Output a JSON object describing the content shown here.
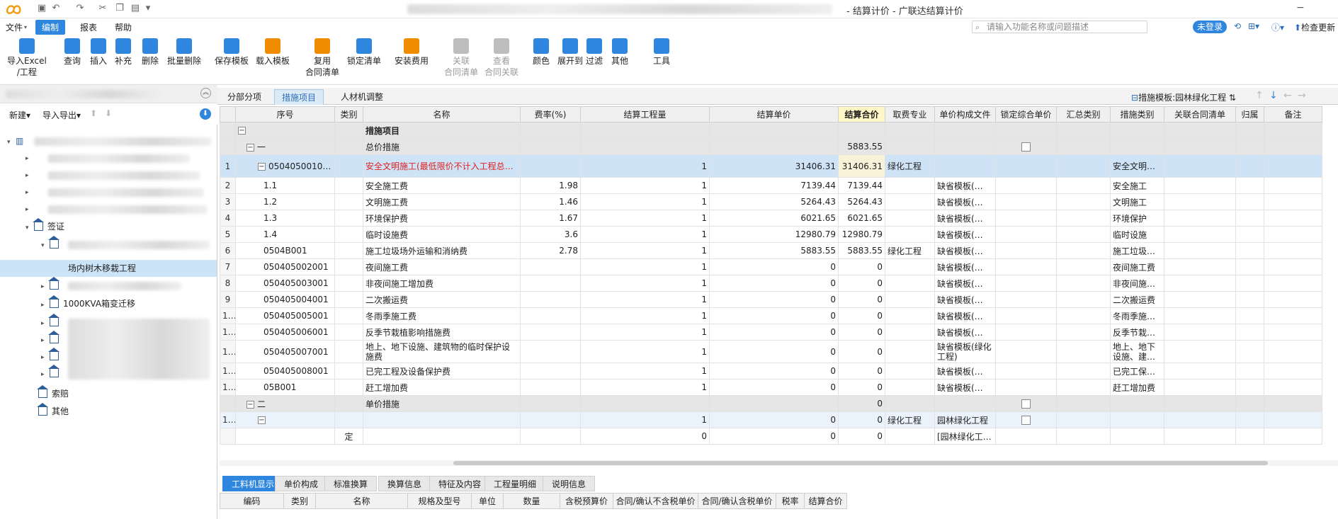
{
  "window": {
    "title": "- 结算计价 - 广联达结算计价"
  },
  "quick_access": [
    "save-icon",
    "undo-icon",
    "redo-icon",
    "cut-icon",
    "copy-icon",
    "paste-icon",
    "more-icon"
  ],
  "menu": [
    "文件",
    "编制",
    "报表",
    "帮助"
  ],
  "search": {
    "placeholder": "请输入功能名称或问题描述"
  },
  "login_label": "未登录",
  "check_update": "检查更新",
  "toolbar": [
    {
      "line1": "导入Excel",
      "line2": "/工程",
      "icon": "import-excel-icon",
      "color": "#2e86de",
      "disabled": false
    },
    {
      "line1": "查询",
      "line2": "",
      "icon": "query-icon",
      "color": "#2e86de",
      "disabled": false
    },
    {
      "line1": "插入",
      "line2": "",
      "icon": "insert-icon",
      "color": "#2e86de",
      "disabled": false
    },
    {
      "line1": "补充",
      "line2": "",
      "icon": "supplement-icon",
      "color": "#2e86de",
      "disabled": false
    },
    {
      "line1": "删除",
      "line2": "",
      "icon": "delete-icon",
      "color": "#2e86de",
      "disabled": false
    },
    {
      "line1": "批量删除",
      "line2": "",
      "icon": "batch-delete-icon",
      "color": "#2e86de",
      "disabled": false
    },
    {
      "line1": "保存模板",
      "line2": "",
      "icon": "save-template-icon",
      "color": "#2e86de",
      "disabled": false
    },
    {
      "line1": "载入模板",
      "line2": "",
      "icon": "load-template-icon",
      "color": "#f08c00",
      "disabled": false
    },
    {
      "line1": "复用",
      "line2": "合同清单",
      "icon": "reuse-list-icon",
      "color": "#f08c00",
      "disabled": false
    },
    {
      "line1": "锁定清单",
      "line2": "",
      "icon": "lock-icon",
      "color": "#2e86de",
      "disabled": false
    },
    {
      "line1": "安装费用",
      "line2": "",
      "icon": "install-fee-icon",
      "color": "#f08c00",
      "disabled": false
    },
    {
      "line1": "关联",
      "line2": "合同清单",
      "icon": "link-list-icon",
      "color": "#bdbdbd",
      "disabled": true
    },
    {
      "line1": "查看",
      "line2": "合同关联",
      "icon": "view-link-icon",
      "color": "#bdbdbd",
      "disabled": true
    },
    {
      "line1": "颜色",
      "line2": "",
      "icon": "color-icon",
      "color": "#2e86de",
      "disabled": false
    },
    {
      "line1": "展开到",
      "line2": "",
      "icon": "expand-icon",
      "color": "#2e86de",
      "disabled": false
    },
    {
      "line1": "过滤",
      "line2": "",
      "icon": "filter-icon",
      "color": "#2e86de",
      "disabled": false
    },
    {
      "line1": "其他",
      "line2": "",
      "icon": "other-icon",
      "color": "#2e86de",
      "disabled": false
    },
    {
      "line1": "工具",
      "line2": "",
      "icon": "tool-icon",
      "color": "#2e86de",
      "disabled": false
    }
  ],
  "left": {
    "new_label": "新建",
    "import_export_label": "导入导出",
    "tree": [
      {
        "label": "签证",
        "level": 1,
        "icon": "house-icon",
        "expanded": true
      },
      {
        "label": "场内树木移栽工程",
        "level": 3,
        "icon": "",
        "selected": true
      },
      {
        "label": "1000KVA箱变迁移",
        "level": 2,
        "icon": "house-icon"
      },
      {
        "label": "索赔",
        "level": 1,
        "icon": "house-icon"
      },
      {
        "label": "其他",
        "level": 1,
        "icon": "house-icon"
      }
    ]
  },
  "tabs": [
    "分部分项",
    "措施项目",
    "人材机调整"
  ],
  "measure_template_label": "措施模板:园林绿化工程",
  "table": {
    "headers": [
      "序号",
      "类别",
      "名称",
      "费率(%)",
      "结算工程量",
      "结算单价",
      "结算合价",
      "取费专业",
      "单价构成文件",
      "锁定综合单价",
      "汇总类别",
      "措施类别",
      "关联合同清单",
      "归属",
      "备注"
    ],
    "rows": [
      {
        "rn": "",
        "code": "",
        "cat": "",
        "name": "措施项目",
        "rate": "",
        "qty": "",
        "price": "",
        "total": "",
        "fee": "",
        "file": "",
        "lock": false,
        "sum": "",
        "mtype": "",
        "type": "grp",
        "bold": true,
        "toggle": "−"
      },
      {
        "rn": "",
        "code": "一",
        "cat": "",
        "name": "总价措施",
        "rate": "",
        "qty": "",
        "price": "",
        "total": "5883.55",
        "fee": "",
        "file": "",
        "lock": true,
        "sum": "",
        "mtype": "",
        "type": "grp",
        "toggle": "−"
      },
      {
        "rn": "1",
        "code": "050405001001",
        "cat": "",
        "name": "安全文明施工(最低限价不计入工程总造价)",
        "rate": "",
        "qty": "1",
        "price": "31406.31",
        "total": "31406.31",
        "fee": "绿化工程",
        "file": "",
        "lock": false,
        "sum": "",
        "mtype": "安全文明施工费",
        "type": "sel",
        "red": true,
        "toggle": "−"
      },
      {
        "rn": "2",
        "code": "1.1",
        "cat": "",
        "name": "安全施工费",
        "rate": "1.98",
        "qty": "1",
        "price": "7139.44",
        "total": "7139.44",
        "fee": "",
        "file": "缺省模板(…",
        "lock": false,
        "sum": "",
        "mtype": "安全施工"
      },
      {
        "rn": "3",
        "code": "1.2",
        "cat": "",
        "name": "文明施工费",
        "rate": "1.46",
        "qty": "1",
        "price": "5264.43",
        "total": "5264.43",
        "fee": "",
        "file": "缺省模板(…",
        "lock": false,
        "sum": "",
        "mtype": "文明施工"
      },
      {
        "rn": "4",
        "code": "1.3",
        "cat": "",
        "name": "环境保护费",
        "rate": "1.67",
        "qty": "1",
        "price": "6021.65",
        "total": "6021.65",
        "fee": "",
        "file": "缺省模板(…",
        "lock": false,
        "sum": "",
        "mtype": "环境保护"
      },
      {
        "rn": "5",
        "code": "1.4",
        "cat": "",
        "name": "临时设施费",
        "rate": "3.6",
        "qty": "1",
        "price": "12980.79",
        "total": "12980.79",
        "fee": "",
        "file": "缺省模板(…",
        "lock": false,
        "sum": "",
        "mtype": "临时设施"
      },
      {
        "rn": "6",
        "code": "0504B001",
        "cat": "",
        "name": "施工垃圾场外运输和消纳费",
        "rate": "2.78",
        "qty": "1",
        "price": "5883.55",
        "total": "5883.55",
        "fee": "绿化工程",
        "file": "缺省模板(…",
        "lock": false,
        "sum": "",
        "mtype": "施工垃圾…"
      },
      {
        "rn": "7",
        "code": "050405002001",
        "cat": "",
        "name": "夜间施工费",
        "rate": "",
        "qty": "1",
        "price": "0",
        "total": "0",
        "fee": "",
        "file": "缺省模板(…",
        "lock": false,
        "sum": "",
        "mtype": "夜间施工费"
      },
      {
        "rn": "8",
        "code": "050405003001",
        "cat": "",
        "name": "非夜间施工增加费",
        "rate": "",
        "qty": "1",
        "price": "0",
        "total": "0",
        "fee": "",
        "file": "缺省模板(…",
        "lock": false,
        "sum": "",
        "mtype": "非夜间施…"
      },
      {
        "rn": "9",
        "code": "050405004001",
        "cat": "",
        "name": "二次搬运费",
        "rate": "",
        "qty": "1",
        "price": "0",
        "total": "0",
        "fee": "",
        "file": "缺省模板(…",
        "lock": false,
        "sum": "",
        "mtype": "二次搬运费"
      },
      {
        "rn": "10",
        "code": "050405005001",
        "cat": "",
        "name": "冬雨季施工费",
        "rate": "",
        "qty": "1",
        "price": "0",
        "total": "0",
        "fee": "",
        "file": "缺省模板(…",
        "lock": false,
        "sum": "",
        "mtype": "冬雨季施…"
      },
      {
        "rn": "11",
        "code": "050405006001",
        "cat": "",
        "name": "反季节栽植影响措施费",
        "rate": "",
        "qty": "1",
        "price": "0",
        "total": "0",
        "fee": "",
        "file": "缺省模板(…",
        "lock": false,
        "sum": "",
        "mtype": "反季节栽…"
      },
      {
        "rn": "12",
        "code": "050405007001",
        "cat": "",
        "name": "地上、地下设施、建筑物的临时保护设施费",
        "rate": "",
        "qty": "1",
        "price": "0",
        "total": "0",
        "fee": "",
        "file": "缺省模板(绿化工程)",
        "lock": false,
        "sum": "",
        "mtype": "地上、地下设施、建…",
        "tall": true
      },
      {
        "rn": "13",
        "code": "050405008001",
        "cat": "",
        "name": "已完工程及设备保护费",
        "rate": "",
        "qty": "1",
        "price": "0",
        "total": "0",
        "fee": "",
        "file": "缺省模板(…",
        "lock": false,
        "sum": "",
        "mtype": "已完工保…"
      },
      {
        "rn": "14",
        "code": "05B001",
        "cat": "",
        "name": "赶工增加费",
        "rate": "",
        "qty": "1",
        "price": "0",
        "total": "0",
        "fee": "",
        "file": "缺省模板(…",
        "lock": false,
        "sum": "",
        "mtype": "赶工增加费"
      },
      {
        "rn": "",
        "code": "二",
        "cat": "",
        "name": "单价措施",
        "rate": "",
        "qty": "",
        "price": "",
        "total": "0",
        "fee": "",
        "file": "",
        "lock": true,
        "sum": "",
        "mtype": "",
        "type": "grp",
        "toggle": "−"
      },
      {
        "rn": "15",
        "code": "",
        "cat": "",
        "name": "",
        "rate": "",
        "qty": "1",
        "price": "0",
        "total": "0",
        "fee": "绿化工程",
        "file": "园林绿化工程",
        "lock": true,
        "sum": "",
        "mtype": "",
        "type": "grp2",
        "toggle": "−"
      },
      {
        "rn": "",
        "code": "",
        "cat": "定",
        "name": "",
        "rate": "",
        "qty": "0",
        "price": "0",
        "total": "0",
        "fee": "",
        "file": "[园林绿化工…",
        "lock": false,
        "sum": "",
        "mtype": ""
      }
    ]
  },
  "bottom_tabs": [
    "工料机显示",
    "单价构成",
    "标准换算",
    "换算信息",
    "特征及内容",
    "工程量明细",
    "说明信息"
  ],
  "bottom_headers": [
    "编码",
    "类别",
    "名称",
    "规格及型号",
    "单位",
    "数量",
    "含税预算价",
    "合同/确认不含税单价",
    "合同/确认含税单价",
    "税率",
    "结算合价"
  ]
}
